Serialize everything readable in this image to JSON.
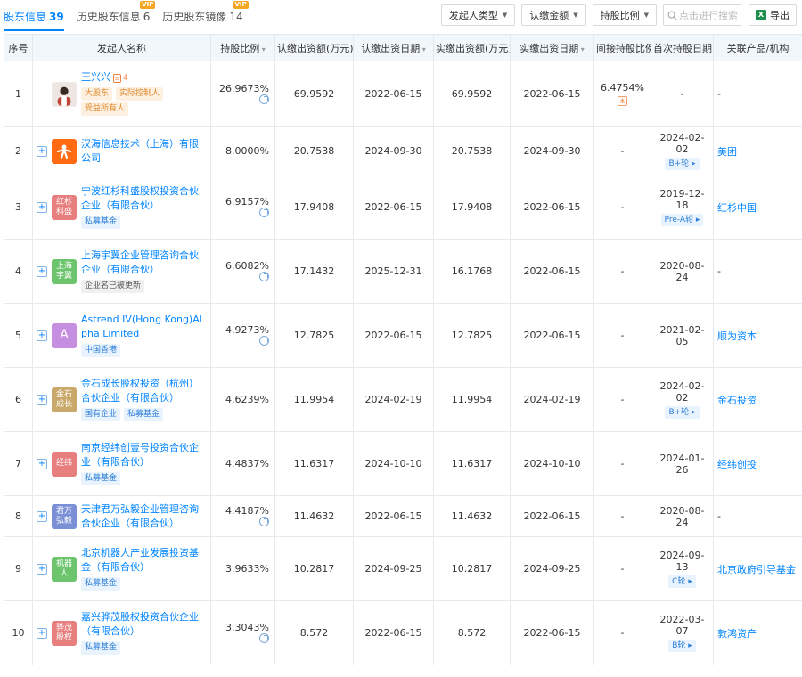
{
  "tabs": [
    {
      "label": "股东信息",
      "count": "39"
    },
    {
      "label": "历史股东信息",
      "count": "6",
      "badge": "VIP"
    },
    {
      "label": "历史股东镜像",
      "count": "14",
      "badge": "VIP"
    }
  ],
  "filters": {
    "type": "发起人类型",
    "amount": "认缴金额",
    "ratio": "持股比例",
    "search_placeholder": "点击进行搜索",
    "export": "导出"
  },
  "headers": [
    "序号",
    "发起人名称",
    "持股比例",
    "认缴出资额(万元)",
    "认缴出资日期",
    "实缴出资额(万元)",
    "实缴出资日期",
    "间接持股比例",
    "首次持股日期",
    "关联产品/机构"
  ],
  "rows": [
    {
      "no": "1",
      "name": "王兴兴",
      "person_count": "4",
      "tags": [
        {
          "text": "大股东",
          "style": "org"
        },
        {
          "text": "实际控制人",
          "style": "org"
        },
        {
          "text": "受益所有人",
          "style": "org"
        }
      ],
      "ratio": "26.9673%",
      "sub_amt": "69.9592",
      "sub_date": "2022-06-15",
      "paid_amt": "69.9592",
      "paid_date": "2022-06-15",
      "indirect": "6.4754%",
      "first_date": "-",
      "round": "",
      "related": "-"
    },
    {
      "no": "2",
      "name": "汉海信息技术（上海）有限公司",
      "logo_text": "",
      "logo_color": "#ff6a13",
      "tags": [],
      "ratio": "8.0000%",
      "sub_amt": "20.7538",
      "sub_date": "2024-09-30",
      "paid_amt": "20.7538",
      "paid_date": "2024-09-30",
      "indirect": "-",
      "first_date": "2024-02-02",
      "round": "B+轮",
      "related": "美团"
    },
    {
      "no": "3",
      "name": "宁波红杉科盛股权投资合伙企业（有限合伙）",
      "logo_text": "红杉科盛",
      "logo_color": "#e87f7f",
      "tags": [
        {
          "text": "私募基金",
          "style": "blu"
        }
      ],
      "ratio": "6.9157%",
      "sub_amt": "17.9408",
      "sub_date": "2022-06-15",
      "paid_amt": "17.9408",
      "paid_date": "2022-06-15",
      "indirect": "-",
      "first_date": "2019-12-18",
      "round": "Pre-A轮",
      "related": "红杉中国"
    },
    {
      "no": "4",
      "name": "上海宇翼企业管理咨询合伙企业（有限合伙）",
      "logo_text": "上海宇翼",
      "logo_color": "#6cc46c",
      "tags": [
        {
          "text": "企业名已被更新",
          "style": "gry"
        }
      ],
      "ratio": "6.6082%",
      "sub_amt": "17.1432",
      "sub_date": "2025-12-31",
      "paid_amt": "16.1768",
      "paid_date": "2022-06-15",
      "indirect": "-",
      "first_date": "2020-08-24",
      "round": "",
      "related": "-"
    },
    {
      "no": "5",
      "name": "Astrend IV(Hong Kong)Alpha Limited",
      "logo_text": "A",
      "logo_color": "#c58ee0",
      "tags": [
        {
          "text": "中国香港",
          "style": "blu"
        }
      ],
      "ratio": "4.9273%",
      "sub_amt": "12.7825",
      "sub_date": "2022-06-15",
      "paid_amt": "12.7825",
      "paid_date": "2022-06-15",
      "indirect": "-",
      "first_date": "2021-02-05",
      "round": "",
      "related": "顺为资本"
    },
    {
      "no": "6",
      "name": "金石成长股权投资（杭州）合伙企业（有限合伙）",
      "logo_text": "金石成长",
      "logo_color": "#c9a86a",
      "tags": [
        {
          "text": "国有企业",
          "style": "blu"
        },
        {
          "text": "私募基金",
          "style": "blu"
        }
      ],
      "ratio": "4.6239%",
      "sub_amt": "11.9954",
      "sub_date": "2024-02-19",
      "paid_amt": "11.9954",
      "paid_date": "2024-02-19",
      "indirect": "-",
      "first_date": "2024-02-02",
      "round": "B+轮",
      "related": "金石投资"
    },
    {
      "no": "7",
      "name": "南京经纬创壹号投资合伙企业（有限合伙）",
      "logo_text": "经纬",
      "logo_color": "#e87f7f",
      "tags": [
        {
          "text": "私募基金",
          "style": "blu"
        }
      ],
      "ratio": "4.4837%",
      "sub_amt": "11.6317",
      "sub_date": "2024-10-10",
      "paid_amt": "11.6317",
      "paid_date": "2024-10-10",
      "indirect": "-",
      "first_date": "2024-01-26",
      "round": "",
      "related": "经纬创投"
    },
    {
      "no": "8",
      "name": "天津君万弘毅企业管理咨询合伙企业（有限合伙）",
      "logo_text": "君万弘毅",
      "logo_color": "#7a8fd6",
      "tags": [],
      "ratio": "4.4187%",
      "sub_amt": "11.4632",
      "sub_date": "2022-06-15",
      "paid_amt": "11.4632",
      "paid_date": "2022-06-15",
      "indirect": "-",
      "first_date": "2020-08-24",
      "round": "",
      "related": "-"
    },
    {
      "no": "9",
      "name": "北京机器人产业发展投资基金（有限合伙）",
      "logo_text": "机器人",
      "logo_color": "#6cc46c",
      "tags": [
        {
          "text": "私募基金",
          "style": "blu"
        }
      ],
      "ratio": "3.9633%",
      "sub_amt": "10.2817",
      "sub_date": "2024-09-25",
      "paid_amt": "10.2817",
      "paid_date": "2024-09-25",
      "indirect": "-",
      "first_date": "2024-09-13",
      "round": "C轮",
      "related": "北京政府引导基金"
    },
    {
      "no": "10",
      "name": "嘉兴骅茂股权投资合伙企业（有限合伙）",
      "logo_text": "骅茂股权",
      "logo_color": "#e87f7f",
      "tags": [
        {
          "text": "私募基金",
          "style": "blu"
        }
      ],
      "ratio": "3.3043%",
      "sub_amt": "8.572",
      "sub_date": "2022-06-15",
      "paid_amt": "8.572",
      "paid_date": "2022-06-15",
      "indirect": "-",
      "first_date": "2022-03-07",
      "round": "B轮",
      "related": "敦鸿资产"
    }
  ]
}
